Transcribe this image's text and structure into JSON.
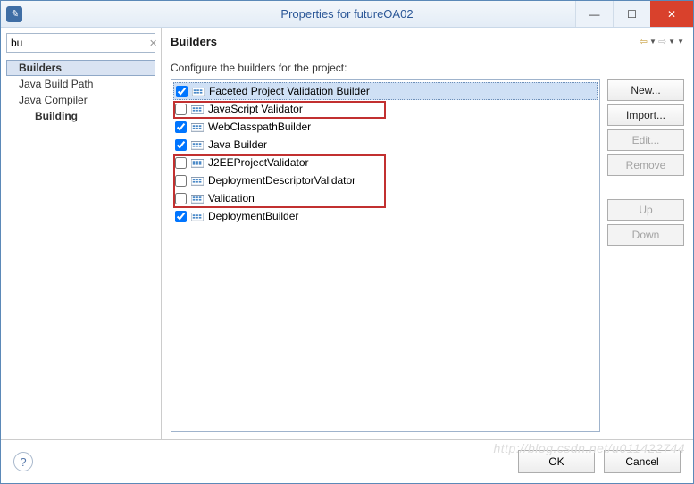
{
  "window": {
    "title": "Properties for futureOA02"
  },
  "filter": {
    "value": "bu"
  },
  "tree": {
    "items": [
      {
        "label": "Builders",
        "selected": true
      },
      {
        "label": "Java Build Path"
      },
      {
        "label": "Java Compiler"
      },
      {
        "label": "Building",
        "level": 2
      }
    ]
  },
  "page": {
    "heading": "Builders",
    "subtitle": "Configure the builders for the project:"
  },
  "builders": [
    {
      "label": "Faceted Project Validation Builder",
      "checked": true,
      "selected": true
    },
    {
      "label": "JavaScript Validator",
      "checked": false
    },
    {
      "label": "WebClasspathBuilder",
      "checked": true
    },
    {
      "label": "Java Builder",
      "checked": true
    },
    {
      "label": "J2EEProjectValidator",
      "checked": false
    },
    {
      "label": "DeploymentDescriptorValidator",
      "checked": false
    },
    {
      "label": "Validation",
      "checked": false
    },
    {
      "label": "DeploymentBuilder",
      "checked": true
    }
  ],
  "buttons": {
    "new": "New...",
    "import": "Import...",
    "edit": "Edit...",
    "remove": "Remove",
    "up": "Up",
    "down": "Down",
    "ok": "OK",
    "cancel": "Cancel"
  },
  "watermark": "http://blog.csdn.net/u011422744"
}
